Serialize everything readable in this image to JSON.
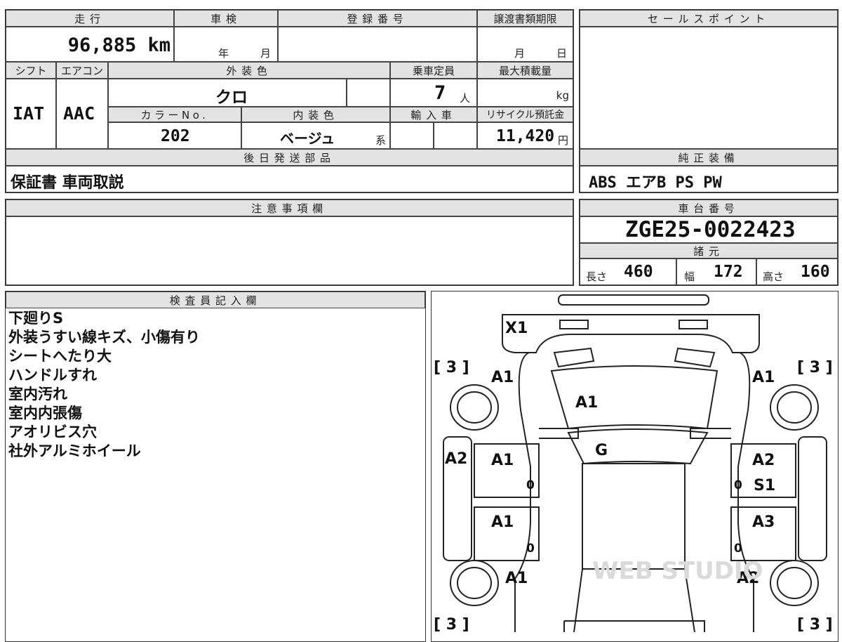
{
  "top": {
    "mileage_header": "走行",
    "mileage_value": "96,885 km",
    "shaken_header": "車検",
    "shaken_year": "年",
    "shaken_month": "月",
    "reg_header": "登録番号",
    "transfer_header": "譲渡書類期限",
    "transfer_month": "月",
    "transfer_day": "日",
    "sales_header": "セールスポイント"
  },
  "spec": {
    "shift_header": "シフト",
    "ac_header": "エアコン",
    "ext_color_header": "外装色",
    "capacity_header": "乗車定員",
    "maxload_header": "最大積載量",
    "shift_value": "IAT",
    "ac_value": "AAC",
    "ext_color_value": "クロ",
    "capacity_value": "7",
    "capacity_unit": "人",
    "maxload_unit": "kg",
    "colorno_header": "カラーNo.",
    "int_color_header": "内装色",
    "import_header": "輸入車",
    "recycle_header": "リサイクル預託金",
    "colorno_value": "202",
    "int_color_value": "ベージュ",
    "int_color_suffix": "系",
    "recycle_value": "11,420",
    "recycle_unit": "円"
  },
  "later_parts": {
    "header": "後日発送部品",
    "value": "保証書 車両取説"
  },
  "genuine_equipment": {
    "header": "純正装備",
    "value": "ABS エアB PS PW"
  },
  "caution": {
    "header": "注意事項欄",
    "value": ""
  },
  "chassis": {
    "header": "車台番号",
    "value": "ZGE25-0022423"
  },
  "dimensions": {
    "header": "諸元",
    "length_label": "長さ",
    "length_value": "460",
    "width_label": "幅",
    "width_value": "172",
    "height_label": "高さ",
    "height_value": "160"
  },
  "inspector": {
    "header": "検査員記入欄",
    "notes": [
      "下廻りS",
      "外装うすい線キズ、小傷有り",
      "シートへたり大",
      "ハンドルすれ",
      "室内汚れ",
      "室内内張傷",
      "アオリビス穴",
      "社外アルミホイール"
    ]
  },
  "diagram": {
    "tire_top_left": "[ 3 ]",
    "tire_top_right": "[ 3 ]",
    "tire_bottom_left": "[ 3 ]",
    "tire_bottom_right": "[ 3 ]",
    "front_bumper": "X1",
    "front_fender_left": "A1",
    "front_fender_right": "A1",
    "hood": "A1",
    "windshield": "G",
    "front_door_left": "A1",
    "front_door_right_1": "A2",
    "front_door_right_2": "S1",
    "side_left": "A2",
    "rear_door_left": "A1",
    "rear_door_right": "A3",
    "rear_fender_left": "A1",
    "rear_fender_right": "A2",
    "front_door_left_zero": "0",
    "front_door_right_zero": "0",
    "rear_door_left_zero": "0",
    "rear_door_right_zero": "0",
    "watermark": "WEB STUDIO"
  }
}
